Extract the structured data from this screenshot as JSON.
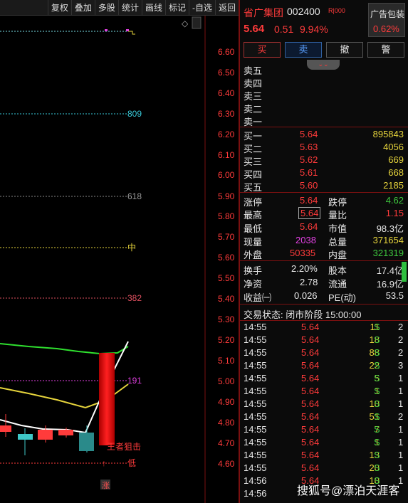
{
  "toolbar": [
    "复权",
    "叠加",
    "多股",
    "统计",
    "画线",
    "标记",
    "-自选",
    "返回"
  ],
  "header": {
    "name": "省广集团",
    "code": "002400",
    "tag": "R|000",
    "price": "5.64",
    "change": "0.51",
    "pct": "9.94%",
    "ad_label": "广告包装",
    "ad_pct": "0.62%"
  },
  "buttons": {
    "buy": "买",
    "sell": "卖",
    "cancel": "撤",
    "alert": "警"
  },
  "sells": [
    "卖五",
    "卖四",
    "卖三",
    "卖二",
    "卖一"
  ],
  "buys": [
    {
      "label": "买一",
      "price": "5.64",
      "vol": "895843"
    },
    {
      "label": "买二",
      "price": "5.63",
      "vol": "4056"
    },
    {
      "label": "买三",
      "price": "5.62",
      "vol": "669"
    },
    {
      "label": "买四",
      "price": "5.61",
      "vol": "668"
    },
    {
      "label": "买五",
      "price": "5.60",
      "vol": "2185"
    }
  ],
  "stats": {
    "zt_l": "涨停",
    "zt_v": "5.64",
    "dt_l": "跌停",
    "dt_v": "4.62",
    "hi_l": "最高",
    "hi_v": "5.64",
    "lb_l": "量比",
    "lb_v": "1.15",
    "lo_l": "最低",
    "lo_v": "5.64",
    "sz_l": "市值",
    "sz_v": "98.3亿",
    "xl_l": "现量",
    "xl_v": "2038",
    "zl_l": "总量",
    "zl_v": "371654",
    "wp_l": "外盘",
    "wp_v": "50335",
    "np_l": "内盘",
    "np_v": "321319",
    "hs_l": "换手",
    "hs_v": "2.20%",
    "gb_l": "股本",
    "gb_v": "17.4亿",
    "jz_l": "净资",
    "jz_v": "2.78",
    "lt_l": "流通",
    "lt_v": "16.9亿",
    "sy_l": "收益㈠",
    "sy_v": "0.026",
    "pe_l": "PE(动)",
    "pe_v": "53.5"
  },
  "status": "交易状态: 闭市阶段 15:00:00",
  "ticks": [
    {
      "t": "14:55",
      "p": "5.64",
      "v": "11",
      "s": "S",
      "n": "2"
    },
    {
      "t": "14:55",
      "p": "5.64",
      "v": "18",
      "s": "S",
      "n": "2"
    },
    {
      "t": "14:55",
      "p": "5.64",
      "v": "88",
      "s": "S",
      "n": "2"
    },
    {
      "t": "14:55",
      "p": "5.64",
      "v": "22",
      "s": "S",
      "n": "3"
    },
    {
      "t": "14:55",
      "p": "5.64",
      "v": "5",
      "s": "S",
      "n": "1"
    },
    {
      "t": "14:55",
      "p": "5.64",
      "v": "1",
      "s": "S",
      "n": "1"
    },
    {
      "t": "14:55",
      "p": "5.64",
      "v": "10",
      "s": "S",
      "n": "1"
    },
    {
      "t": "14:55",
      "p": "5.64",
      "v": "51",
      "s": "S",
      "n": "2"
    },
    {
      "t": "14:55",
      "p": "5.64",
      "v": "7",
      "s": "S",
      "n": "1"
    },
    {
      "t": "14:55",
      "p": "5.64",
      "v": "1",
      "s": "S",
      "n": "1"
    },
    {
      "t": "14:55",
      "p": "5.64",
      "v": "13",
      "s": "S",
      "n": "1"
    },
    {
      "t": "14:55",
      "p": "5.64",
      "v": "20",
      "s": "S",
      "n": "1"
    },
    {
      "t": "14:56",
      "p": "5.64",
      "v": "10",
      "s": "S",
      "n": "1"
    },
    {
      "t": "14:56",
      "p": "",
      "v": "",
      "s": "",
      "n": ""
    }
  ],
  "axis_labels": [
    "6.60",
    "6.50",
    "6.40",
    "6.30",
    "6.20",
    "6.10",
    "6.00",
    "5.90",
    "5.80",
    "5.70",
    "5.60",
    "5.50",
    "5.40",
    "5.30",
    "5.20",
    "5.10",
    "5.00",
    "4.90",
    "4.80",
    "4.70",
    "4.60"
  ],
  "levels": {
    "l809": "809",
    "l618": "618",
    "mid": "中",
    "l382": "382",
    "l191": "191",
    "low": "低",
    "kill": "王者狙击",
    "zhang": "涨",
    "corner_mark": "◇"
  },
  "watermark": "搜狐号@漂泊天涯客",
  "colors": {
    "red": "#ff3b3b",
    "green": "#3ec83e",
    "yellow": "#e6d43c",
    "cyan": "#38c8d8",
    "magenta": "#e040e0"
  }
}
